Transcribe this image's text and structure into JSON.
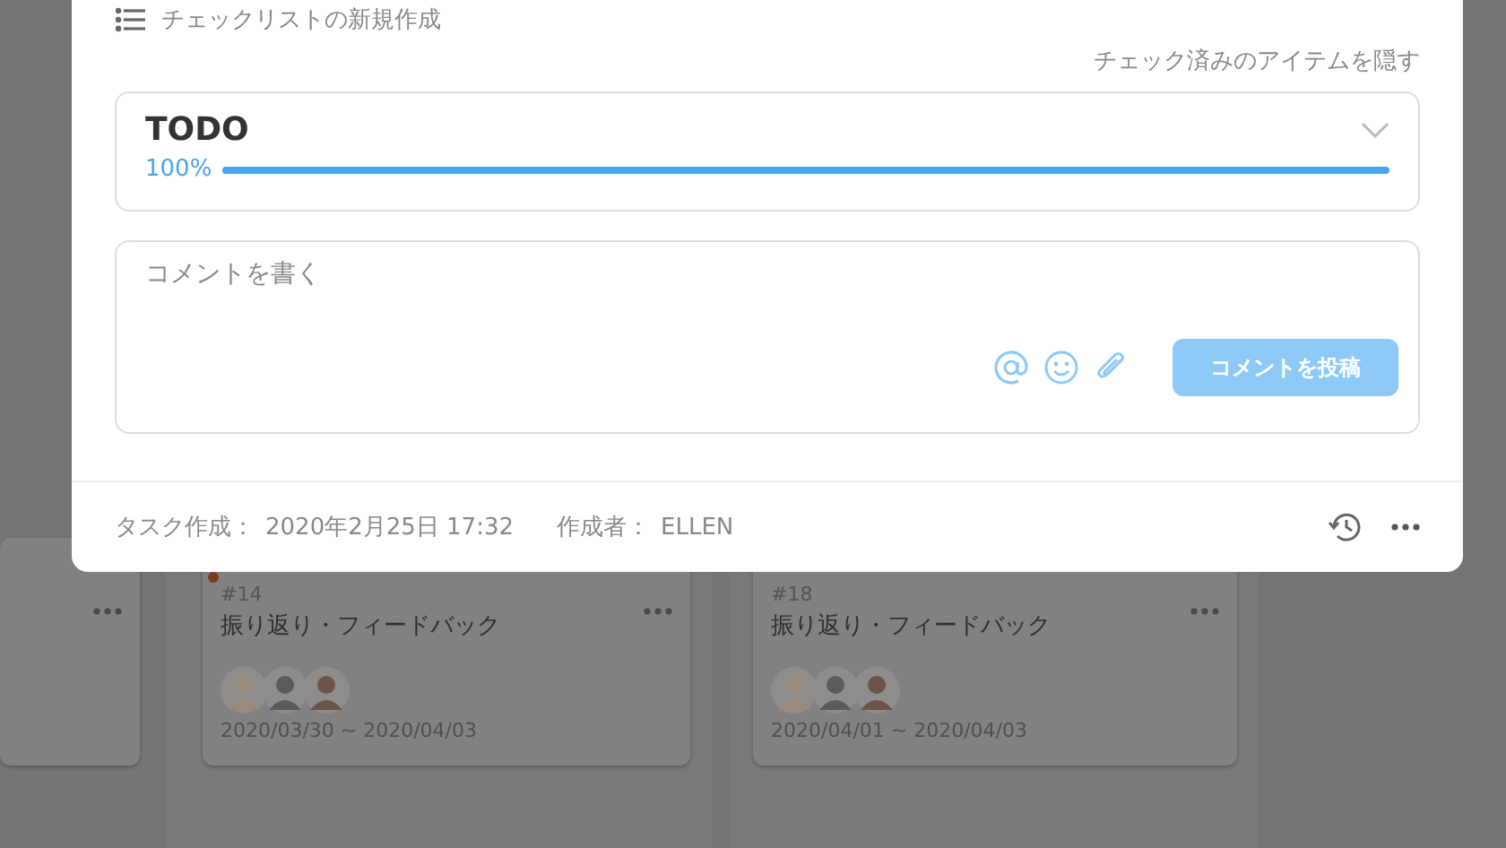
{
  "checklist_header": {
    "title": "チェックリストの新規作成"
  },
  "hide_checked_link": "チェック済みのアイテムを隠す",
  "checklist": {
    "title": "TODO",
    "expanded": false,
    "progress_text": "100%",
    "level": 1.0
  },
  "comment": {
    "placeholder": "コメントを書く",
    "submit": "コメントを投稿",
    "disabled": true
  },
  "footer": {
    "created_label": "タスク作成：",
    "created_value": "2020年2月25日 17:32",
    "author_label": "作成者：",
    "author_value": "ELLEN"
  },
  "board_cards": [
    {
      "kind": "partial"
    },
    {
      "kind": "task",
      "number": "#14",
      "title": "振り返り・フィードバック",
      "dates": "2020/03/30 ~ 2020/04/03",
      "color": "#7a3a20"
    },
    {
      "kind": "task",
      "number": "#18",
      "title": "振り返り・フィードバック",
      "dates": "2020/04/01 ~ 2020/04/03"
    }
  ]
}
